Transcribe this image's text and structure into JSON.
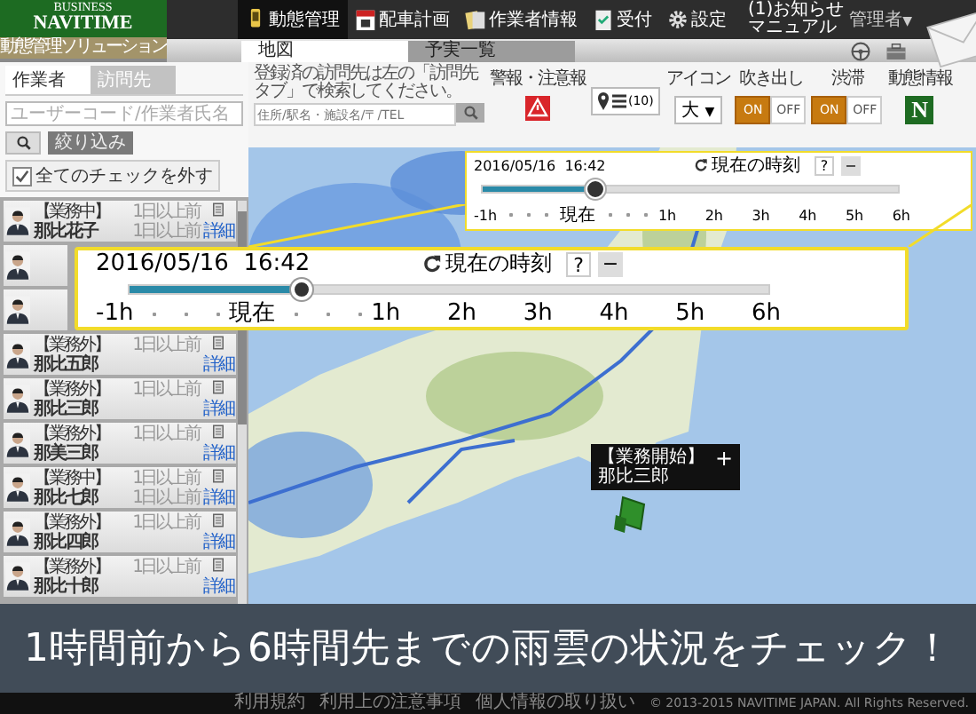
{
  "header": {
    "logo_top": "BUSINESS",
    "logo_name": "NAVITIME",
    "logo_sub": "動態管理ソリューション",
    "nav": [
      {
        "label": "動態管理",
        "selected": true
      },
      {
        "label": "配車計画",
        "selected": false
      },
      {
        "label": "作業者情報",
        "selected": false
      },
      {
        "label": "受付",
        "selected": false
      },
      {
        "label": "設定",
        "selected": false
      }
    ],
    "notice": "(1)お知らせ",
    "manual": "マニュアル",
    "user": "管理者",
    "user_caret": "▼"
  },
  "map_tabs": [
    {
      "label": "地図",
      "selected": true
    },
    {
      "label": "予実一覧",
      "selected": false
    }
  ],
  "sidebar": {
    "tabs": [
      {
        "label": "作業者",
        "selected": true
      },
      {
        "label": "訪問先",
        "selected": false
      }
    ],
    "search_placeholder": "ユーザーコード/作業者氏名",
    "filter_button": "絞り込み",
    "uncheck_all": {
      "label": "全てのチェックを外す",
      "checked": true
    },
    "workers": [
      {
        "avatar": true,
        "status": "【業務中】",
        "name": "那比花子",
        "time": "1日以上前",
        "time_2": "1日以上前",
        "detail": "詳細"
      },
      {
        "avatar": true
      },
      {
        "avatar": true
      },
      {
        "avatar": true,
        "status": "【業務外】",
        "name": "那比五郎",
        "time": "1日以上前",
        "detail": "詳細"
      },
      {
        "avatar": true,
        "status": "【業務外】",
        "name": "那比三郎",
        "time": "1日以上前",
        "detail": "詳細"
      },
      {
        "avatar": true,
        "status": "【業務外】",
        "name": "那美三郎",
        "time": "1日以上前",
        "detail": "詳細"
      },
      {
        "avatar": true,
        "status": "【業務中】",
        "name": "那比七郎",
        "time": "1日以上前",
        "time_2": "1日以上前",
        "detail": "詳細"
      },
      {
        "avatar": true,
        "status": "【業務外】",
        "name": "那比四郎",
        "time": "1日以上前",
        "detail": "詳細"
      },
      {
        "avatar": true,
        "status": "【業務外】",
        "name": "那比十郎",
        "time": "1日以上前",
        "detail": "詳細"
      }
    ]
  },
  "map_toolbar": {
    "hint": "登録済の訪問先は左の「訪問先タブ」で検索してください。",
    "search_placeholder": "住所/駅名・施設名/〒/TEL",
    "warning_label": "警報・注意報",
    "pin_count": "(10)",
    "icon_label": "アイコン",
    "icon_size": "大",
    "icon_caret": "▼",
    "toggles": [
      {
        "label": "吹き出し",
        "on": true,
        "on_text": "ON",
        "off_text": "OFF"
      },
      {
        "label": "渋滞",
        "on": true,
        "on_text": "ON",
        "off_text": "OFF"
      }
    ],
    "status_label": "動態情報",
    "status_letter": "N"
  },
  "time_panel": {
    "date": "2016/05/16  16:42",
    "reset_label": "現在の時刻",
    "help": "?",
    "minimize": "−",
    "level": 0.27,
    "scale": [
      "-1h",
      "現在",
      "1h",
      "2h",
      "3h",
      "4h",
      "5h",
      "6h"
    ]
  },
  "time_panel_zoomed": {
    "date": "2016/05/16  16:42",
    "reset_label": "現在の時刻",
    "help": "?",
    "minimize": "−",
    "level": 0.27,
    "scale": [
      "-1h",
      "現在",
      "1h",
      "2h",
      "3h",
      "4h",
      "5h",
      "6h"
    ]
  },
  "marker_popup": {
    "status": "【業務開始】",
    "name": "那比三郎",
    "expand": "+"
  },
  "caption": "1時間前から6時間先までの雨雲の状況をチェック！",
  "footer": {
    "links": [
      "利用規約",
      "利用上の注意事項",
      "個人情報の取り扱い"
    ],
    "copyright": "© 2013-2015 NAVITIME JAPAN. All Rights Reserved."
  }
}
